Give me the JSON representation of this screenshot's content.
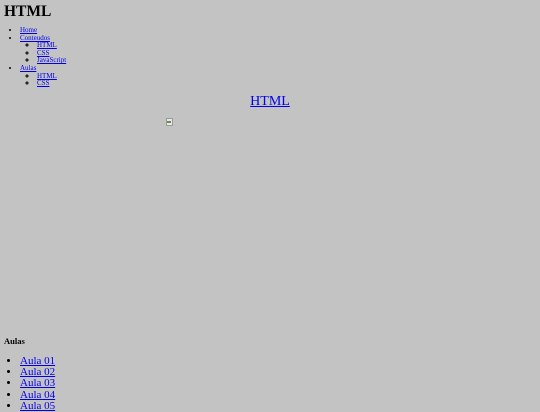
{
  "header": {
    "title": "HTML"
  },
  "nav": {
    "home": "Home",
    "conteudos": {
      "label": "Conteudos",
      "items": [
        "HTML",
        "CSS",
        "JavaScript"
      ]
    },
    "aulas": {
      "label": "Aulas",
      "items": [
        "HTML",
        "CSS"
      ]
    }
  },
  "main": {
    "heading": "HTML",
    "image_icon": "broken-image-icon"
  },
  "aulas_section": {
    "heading": "Aulas",
    "items": [
      "Aula 01",
      "Aula 02",
      "Aula 03",
      "Aula 04",
      "Aula 05"
    ]
  },
  "colors": {
    "background": "#c3c3c3",
    "link": "#0000ee"
  }
}
